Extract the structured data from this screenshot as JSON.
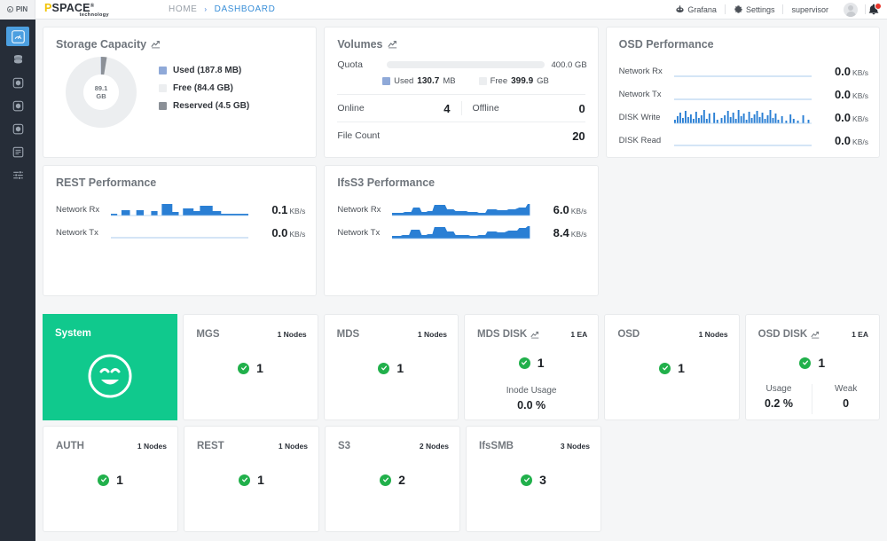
{
  "topbar": {
    "pin_label": "PIN",
    "logo_p": "P",
    "logo_rest": "SPACE",
    "logo_reg": "®",
    "logo_sub": "technology",
    "breadcrumb_home": "HOME",
    "breadcrumb_sep": "›",
    "breadcrumb_active": "DASHBOARD",
    "grafana": "Grafana",
    "settings": "Settings",
    "user": "supervisor"
  },
  "sidebar": {
    "items": [
      {
        "name": "dashboard",
        "active": true
      },
      {
        "name": "storage",
        "active": false
      },
      {
        "name": "volume",
        "active": false
      },
      {
        "name": "object",
        "active": false
      },
      {
        "name": "cluster",
        "active": false
      },
      {
        "name": "logs",
        "active": false
      },
      {
        "name": "settings",
        "active": false
      }
    ]
  },
  "storage": {
    "title": "Storage Capacity",
    "total_value": "89.1",
    "total_unit": "GB",
    "legend": [
      {
        "label": "Used (187.8 MB)",
        "color": "#8fa9d8"
      },
      {
        "label": "Free (84.4 GB)",
        "color": "#eceef0"
      },
      {
        "label": "Reserved (4.5 GB)",
        "color": "#8b9097"
      }
    ]
  },
  "volumes": {
    "title": "Volumes",
    "quota_label": "Quota",
    "quota_max": "400.0 GB",
    "quota_used_pct": 0.03,
    "used_label": "Used",
    "used_value": "130.7",
    "used_unit": "MB",
    "free_label": "Free",
    "free_value": "399.9",
    "free_unit": "GB",
    "online_label": "Online",
    "online_value": "4",
    "offline_label": "Offline",
    "offline_value": "0",
    "filecount_label": "File Count",
    "filecount_value": "20"
  },
  "osd_performance": {
    "title": "OSD Performance",
    "rows": [
      {
        "label": "Network Rx",
        "value": "0.0",
        "unit": "KB/s",
        "spark": "flat"
      },
      {
        "label": "Network Tx",
        "value": "0.0",
        "unit": "KB/s",
        "spark": "flat"
      },
      {
        "label": "DISK Write",
        "value": "0.0",
        "unit": "KB/s",
        "spark": "spiky"
      },
      {
        "label": "DISK Read",
        "value": "0.0",
        "unit": "KB/s",
        "spark": "flat"
      }
    ]
  },
  "rest_performance": {
    "title": "REST Performance",
    "rows": [
      {
        "label": "Network Rx",
        "value": "0.1",
        "unit": "KB/s",
        "spark": "stepped"
      },
      {
        "label": "Network Tx",
        "value": "0.0",
        "unit": "KB/s",
        "spark": "flat"
      }
    ]
  },
  "ifss3_performance": {
    "title": "IfsS3 Performance",
    "rows": [
      {
        "label": "Network Rx",
        "value": "6.0",
        "unit": "KB/s",
        "spark": "wave1"
      },
      {
        "label": "Network Tx",
        "value": "8.4",
        "unit": "KB/s",
        "spark": "wave2"
      }
    ]
  },
  "cards_row1": [
    {
      "type": "system",
      "title": "System"
    },
    {
      "type": "simple",
      "title": "MGS",
      "count": "1 Nodes",
      "status": "1"
    },
    {
      "type": "simple",
      "title": "MDS",
      "count": "1 Nodes",
      "status": "1"
    },
    {
      "type": "sub",
      "title": "MDS DISK",
      "has_chart_icon": true,
      "count": "1 EA",
      "status": "1",
      "sub_label": "Inode Usage",
      "sub_value": "0.0 %"
    },
    {
      "type": "simple",
      "title": "OSD",
      "count": "1 Nodes",
      "status": "1"
    },
    {
      "type": "split",
      "title": "OSD DISK",
      "has_chart_icon": true,
      "count": "1 EA",
      "status": "1",
      "left_label": "Usage",
      "left_value": "0.2 %",
      "right_label": "Weak",
      "right_value": "0"
    }
  ],
  "cards_row2": [
    {
      "type": "simple",
      "title": "AUTH",
      "count": "1 Nodes",
      "status": "1"
    },
    {
      "type": "simple",
      "title": "REST",
      "count": "1 Nodes",
      "status": "1"
    },
    {
      "type": "simple",
      "title": "S3",
      "count": "2 Nodes",
      "status": "2"
    },
    {
      "type": "simple",
      "title": "IfsSMB",
      "count": "3 Nodes",
      "status": "3"
    }
  ],
  "colors": {
    "accent_teal": "#10c98d",
    "accent_blue": "#3a8fd8",
    "spark_blue": "#2a7fd4",
    "status_green": "#21b04b",
    "badge_red": "#e8342a",
    "sidebar_bg": "#262d38"
  }
}
